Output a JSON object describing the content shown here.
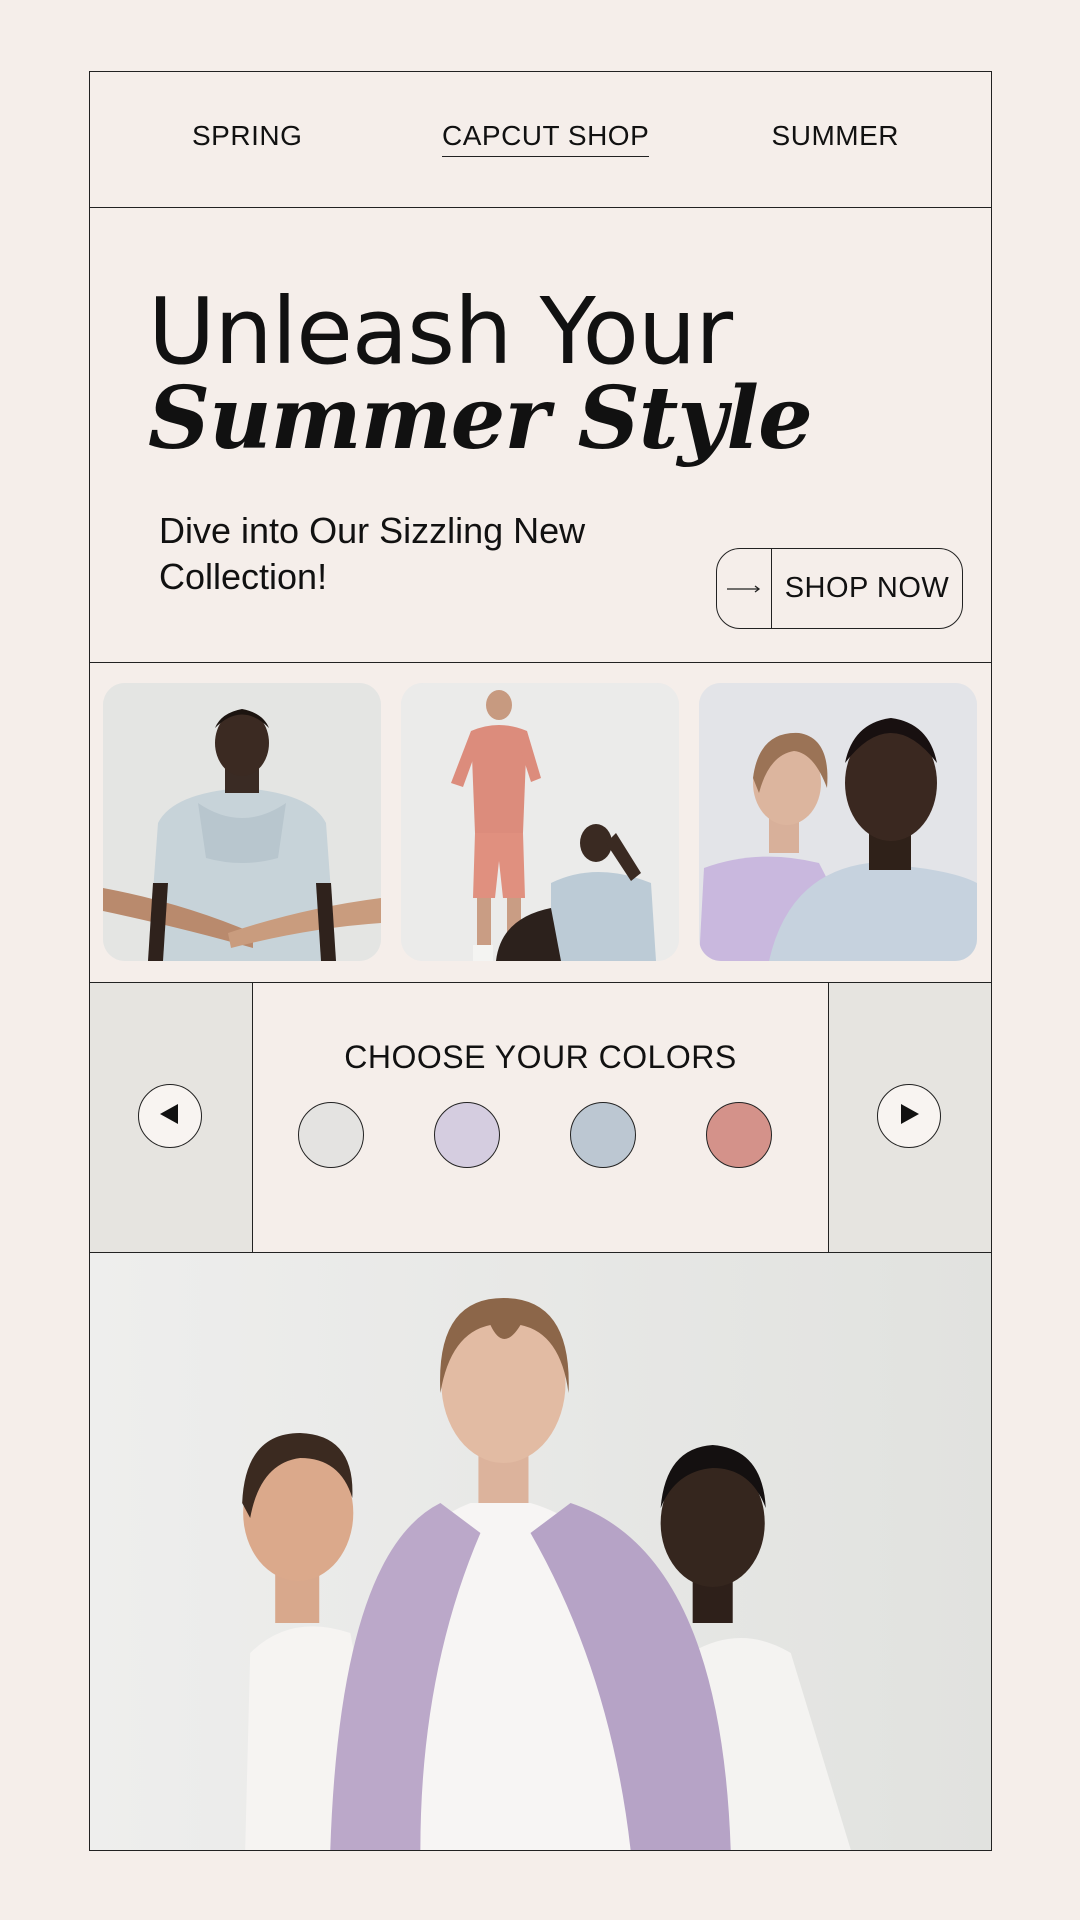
{
  "nav": {
    "items": [
      {
        "label": "SPRING"
      },
      {
        "label": "CAPCUT SHOP"
      },
      {
        "label": "SUMMER"
      }
    ]
  },
  "hero": {
    "headline_line1": "Unleash Your",
    "headline_line2": "Summer Style",
    "subtitle": "Dive into Our Sizzling New Collection!",
    "cta_label": "SHOP NOW",
    "cta_icon": "arrow-right-icon"
  },
  "gallery": {
    "images": [
      {
        "alt": "model-in-light-blue-hoodie-handshake"
      },
      {
        "alt": "models-in-coral-set-and-blue-hoodie"
      },
      {
        "alt": "models-in-lavender-and-blue-tops"
      }
    ]
  },
  "color_picker": {
    "title": "CHOOSE YOUR COLORS",
    "prev_icon": "triangle-left-icon",
    "next_icon": "triangle-right-icon",
    "swatches": [
      {
        "name": "light-gray",
        "color": "#e4e3e1"
      },
      {
        "name": "lavender",
        "color": "#d5cde0"
      },
      {
        "name": "light-blue-gray",
        "color": "#bcc7d2"
      },
      {
        "name": "dusty-coral",
        "color": "#d4928a"
      }
    ]
  },
  "colors": {
    "background": "#f5eeea",
    "line": "#222222",
    "panel": "#e6e4e0"
  }
}
